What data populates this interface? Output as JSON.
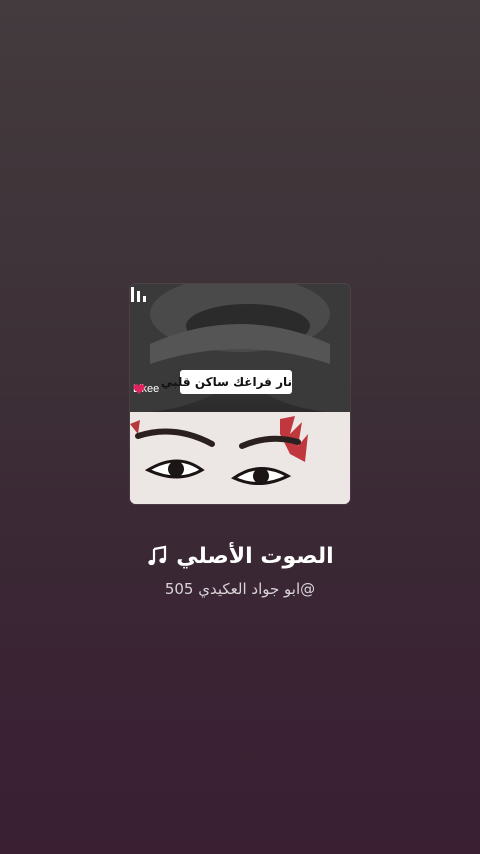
{
  "album_art": {
    "caption": "نار فراغك ساكن قلبي",
    "watermark_text": "Likee"
  },
  "sound": {
    "title": "الصوت الأصلي",
    "author": "@ابو جواد العكيدي 505"
  },
  "colors": {
    "accent_heart": "#e0245e",
    "text_primary": "#ffffff",
    "text_secondary": "#d9d4d8"
  },
  "icons": [
    "music-note-icon",
    "pause-icon",
    "likee-heart-icon"
  ]
}
